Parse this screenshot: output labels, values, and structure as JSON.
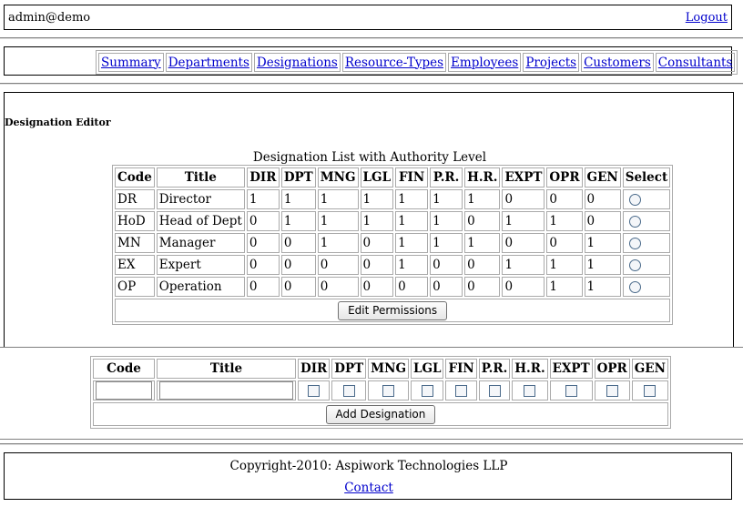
{
  "header": {
    "user": "admin@demo",
    "logout": "Logout"
  },
  "nav": [
    "Summary",
    "Departments",
    "Designations",
    "Resource-Types",
    "Employees",
    "Projects",
    "Customers",
    "Consultants"
  ],
  "editor": {
    "title": "Designation Editor",
    "list_caption": "Designation List with Authority Level",
    "columns": [
      "Code",
      "Title",
      "DIR",
      "DPT",
      "MNG",
      "LGL",
      "FIN",
      "P.R.",
      "H.R.",
      "EXPT",
      "OPR",
      "GEN",
      "Select"
    ],
    "rows": [
      {
        "code": "DR",
        "title": "Director",
        "vals": [
          "1",
          "1",
          "1",
          "1",
          "1",
          "1",
          "1",
          "0",
          "0",
          "0"
        ]
      },
      {
        "code": "HoD",
        "title": "Head of Dept",
        "vals": [
          "0",
          "1",
          "1",
          "1",
          "1",
          "1",
          "0",
          "1",
          "1",
          "0"
        ]
      },
      {
        "code": "MN",
        "title": "Manager",
        "vals": [
          "0",
          "0",
          "1",
          "0",
          "1",
          "1",
          "1",
          "0",
          "0",
          "1"
        ]
      },
      {
        "code": "EX",
        "title": "Expert",
        "vals": [
          "0",
          "0",
          "0",
          "0",
          "1",
          "0",
          "0",
          "1",
          "1",
          "1"
        ]
      },
      {
        "code": "OP",
        "title": "Operation",
        "vals": [
          "0",
          "0",
          "0",
          "0",
          "0",
          "0",
          "0",
          "0",
          "1",
          "1"
        ]
      }
    ],
    "edit_button": "Edit Permissions"
  },
  "add": {
    "columns": [
      "Code",
      "Title",
      "DIR",
      "DPT",
      "MNG",
      "LGL",
      "FIN",
      "P.R.",
      "H.R.",
      "EXPT",
      "OPR",
      "GEN"
    ],
    "code_value": "",
    "title_value": "",
    "add_button": "Add Designation"
  },
  "footer": {
    "copyright": "Copyright-2010: Aspiwork Technologies LLP",
    "contact": "Contact"
  }
}
